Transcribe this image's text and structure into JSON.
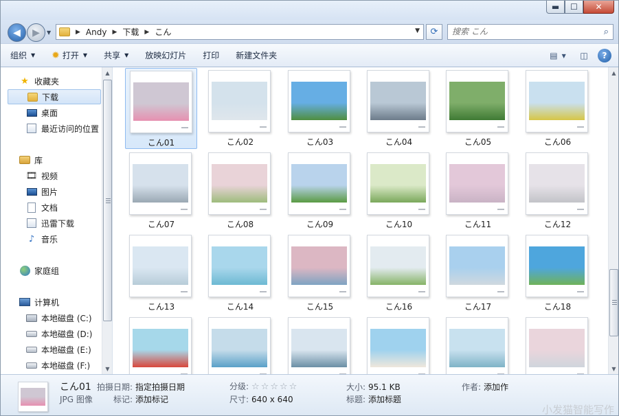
{
  "window": {
    "minimize": "▬",
    "maximize": "☐",
    "close": "✕"
  },
  "nav": {
    "back_glyph": "◀",
    "forward_glyph": "▶",
    "breadcrumb": [
      "Andy",
      "下载",
      "こん"
    ],
    "crumb_sep": "▶",
    "dropdown_glyph": "▼",
    "refresh_glyph": "⟳",
    "search_placeholder": "搜索 こん",
    "search_glyph": "⌕"
  },
  "toolbar": {
    "organize": "组织",
    "open": "打开",
    "share": "共享",
    "slideshow": "放映幻灯片",
    "print": "打印",
    "new_folder": "新建文件夹",
    "arrow": "▼",
    "view_glyph": "▤",
    "preview_glyph": "◫",
    "help_glyph": "?"
  },
  "sidebar": {
    "favorites": "收藏夹",
    "downloads": "下载",
    "desktop": "桌面",
    "recent": "最近访问的位置",
    "libraries": "库",
    "videos": "视频",
    "pictures": "图片",
    "documents": "文档",
    "thunder": "迅雷下载",
    "music": "音乐",
    "homegroup": "家庭组",
    "computer": "计算机",
    "drive_c": "本地磁盘 (C:)",
    "drive_d": "本地磁盘 (D:)",
    "drive_e": "本地磁盘 (E:)",
    "drive_f": "本地磁盘 (F:)"
  },
  "files": [
    {
      "name": "こん01",
      "sky": "#cfc7d3",
      "ground": "#e690b0"
    },
    {
      "name": "こん02",
      "sky": "#d4e2ec",
      "ground": "#dfe6ec"
    },
    {
      "name": "こん03",
      "sky": "#66aee4",
      "ground": "#4f8e3f"
    },
    {
      "name": "こん04",
      "sky": "#b9c8d5",
      "ground": "#6c7b8a"
    },
    {
      "name": "こん05",
      "sky": "#7fae6a",
      "ground": "#3f7a34"
    },
    {
      "name": "こん06",
      "sky": "#c9e0ef",
      "ground": "#d6c646"
    },
    {
      "name": "こん07",
      "sky": "#d6e1ec",
      "ground": "#9aa8b3"
    },
    {
      "name": "こん08",
      "sky": "#e9d3d8",
      "ground": "#9dbc7c"
    },
    {
      "name": "こん09",
      "sky": "#b9d3ec",
      "ground": "#5a9a43"
    },
    {
      "name": "こん10",
      "sky": "#dbe9c8",
      "ground": "#7aa85b"
    },
    {
      "name": "こん11",
      "sky": "#e3c8d9",
      "ground": "#c9b3c5"
    },
    {
      "name": "こん12",
      "sky": "#e6e2e8",
      "ground": "#c2c3c8"
    },
    {
      "name": "こん13",
      "sky": "#dae7f2",
      "ground": "#b7ccd8"
    },
    {
      "name": "こん14",
      "sky": "#a9d7ec",
      "ground": "#6db9d3"
    },
    {
      "name": "こん15",
      "sky": "#dcb7c3",
      "ground": "#7ea3c2"
    },
    {
      "name": "こん16",
      "sky": "#e3ebf0",
      "ground": "#86b367"
    },
    {
      "name": "こん17",
      "sky": "#a9d0ee",
      "ground": "#cfd8df"
    },
    {
      "name": "こん18",
      "sky": "#4ea6dd",
      "ground": "#6fb25a"
    },
    {
      "name": "",
      "sky": "#a6d8ea",
      "ground": "#d9473c"
    },
    {
      "name": "",
      "sky": "#c5dcea",
      "ground": "#5aa0c8"
    },
    {
      "name": "",
      "sky": "#d9e5ef",
      "ground": "#6b8fa5"
    },
    {
      "name": "",
      "sky": "#9fd2ee",
      "ground": "#efe7dc"
    },
    {
      "name": "",
      "sky": "#c8e1ef",
      "ground": "#7fb3c7"
    },
    {
      "name": "",
      "sky": "#ead5dc",
      "ground": "#cfd5dc"
    }
  ],
  "details": {
    "name": "こん01",
    "type": "JPG 图像",
    "date_label": "拍摄日期:",
    "date_value": "指定拍摄日期",
    "tags_label": "标记:",
    "tags_value": "添加标记",
    "rating_label": "分级:",
    "rating_stars": "☆☆☆☆☆",
    "dims_label": "尺寸:",
    "dims_value": "640 x 640",
    "size_label": "大小:",
    "size_value": "95.1 KB",
    "title_label": "标题:",
    "title_value": "添加标题",
    "author_label": "作者:",
    "author_value": "添加作"
  },
  "watermark": "小发猫智能写作"
}
